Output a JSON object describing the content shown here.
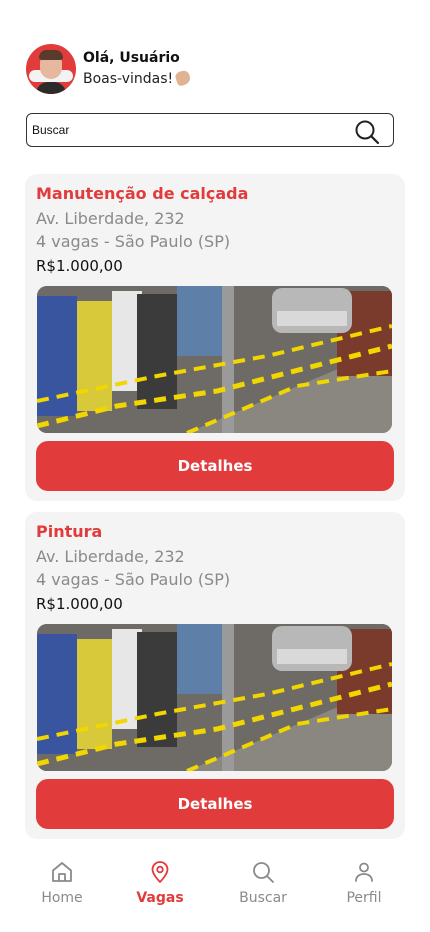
{
  "user": {
    "greeting": "Olá, Usuário",
    "welcome": "Boas-vindas!"
  },
  "search": {
    "placeholder": "Buscar"
  },
  "cards": [
    {
      "title": "Manutenção de calçada",
      "address": "Av. Liberdade, 232",
      "spots": "4 vagas - São Paulo (SP)",
      "price": "R$1.000,00",
      "button": "Detalhes"
    },
    {
      "title": "Pintura",
      "address": "Av. Liberdade, 232",
      "spots": "4 vagas - São Paulo (SP)",
      "price": "R$1.000,00",
      "button": "Detalhes"
    }
  ],
  "nav": [
    {
      "label": "Home",
      "icon": "home-icon",
      "active": false
    },
    {
      "label": "Vagas",
      "icon": "location-pin-icon",
      "active": true
    },
    {
      "label": "Buscar",
      "icon": "search-icon",
      "active": false
    },
    {
      "label": "Perfil",
      "icon": "user-icon",
      "active": false
    }
  ],
  "colors": {
    "accent": "#e23b3b",
    "muted": "#8a8a8a",
    "card_bg": "#f4f4f4"
  }
}
